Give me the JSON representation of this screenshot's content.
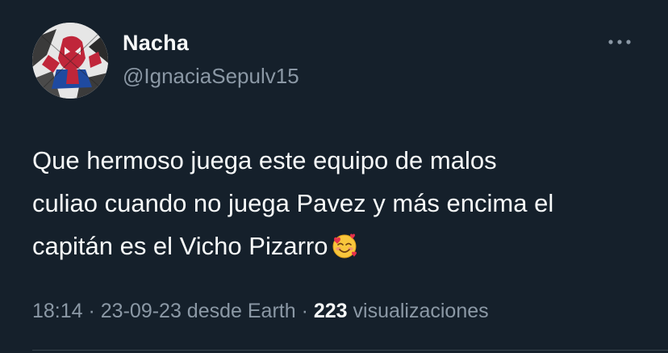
{
  "author": {
    "display_name": "Nacha",
    "handle": "@IgnaciaSepulv15",
    "avatar_icon": "spider-man-avatar"
  },
  "tweet": {
    "text": "Que hermoso juega este equipo de malos\nculiao cuando no juega Pavez y más encima el\ncapitán es el Vicho Pizarro",
    "emoji": "smiling-face-with-hearts-icon"
  },
  "meta": {
    "time": "18:14",
    "sep1": " · ",
    "date": "23-09-23",
    "source": " desde Earth",
    "sep2": " · ",
    "views_count": "223",
    "views_label": " visualizaciones"
  },
  "colors": {
    "background": "#15202b",
    "primary_text": "#f7f9f9",
    "secondary_text": "#8b98a5"
  }
}
